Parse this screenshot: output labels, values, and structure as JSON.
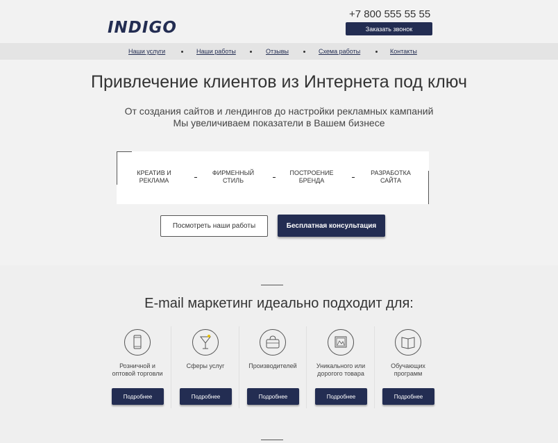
{
  "header": {
    "logo": "INDIGO",
    "phone": "+7 800 555 55 55",
    "call_button": "Заказать звонок"
  },
  "nav": {
    "items": [
      {
        "label": "Наши услуги"
      },
      {
        "label": "Наши работы"
      },
      {
        "label": "Отзывы"
      },
      {
        "label": "Схема работы"
      },
      {
        "label": "Контакты"
      }
    ]
  },
  "hero": {
    "title": "Привлечение клиентов из Интернета под ключ",
    "subtitle_line1": "От создания сайтов и лендингов до настройки рекламных кампаний",
    "subtitle_line2": "Мы увеличиваем показатели в Вашем бизнесе",
    "services": [
      {
        "line1": "Креатив и",
        "line2": "реклама"
      },
      {
        "line1": "Фирменный",
        "line2": "стиль"
      },
      {
        "line1": "Построение",
        "line2": "бренда"
      },
      {
        "line1": "Разработка",
        "line2": "сайта"
      }
    ],
    "btn_works": "Посмотреть наши работы",
    "btn_consult": "Бесплатная консультация"
  },
  "email_section": {
    "title": "E-mail маркетинг идеально подходит для:",
    "cards": [
      {
        "icon": "phone-icon",
        "line1": "Розничной и",
        "line2": "оптовой торговли",
        "button": "Подробнее"
      },
      {
        "icon": "cocktail-icon",
        "line1": "Сферы услуг",
        "line2": "",
        "button": "Подробнее"
      },
      {
        "icon": "bag-icon",
        "line1": "Производителей",
        "line2": "",
        "button": "Подробнее"
      },
      {
        "icon": "picture-icon",
        "line1": "Уникального или",
        "line2": "дорогого товара",
        "button": "Подробнее"
      },
      {
        "icon": "book-icon",
        "line1": "Обучающих",
        "line2": "программ",
        "button": "Подробнее"
      }
    ]
  },
  "colors": {
    "brand": "#232d52",
    "background": "#f2f2f2",
    "nav_bg": "#e4e4e4"
  }
}
